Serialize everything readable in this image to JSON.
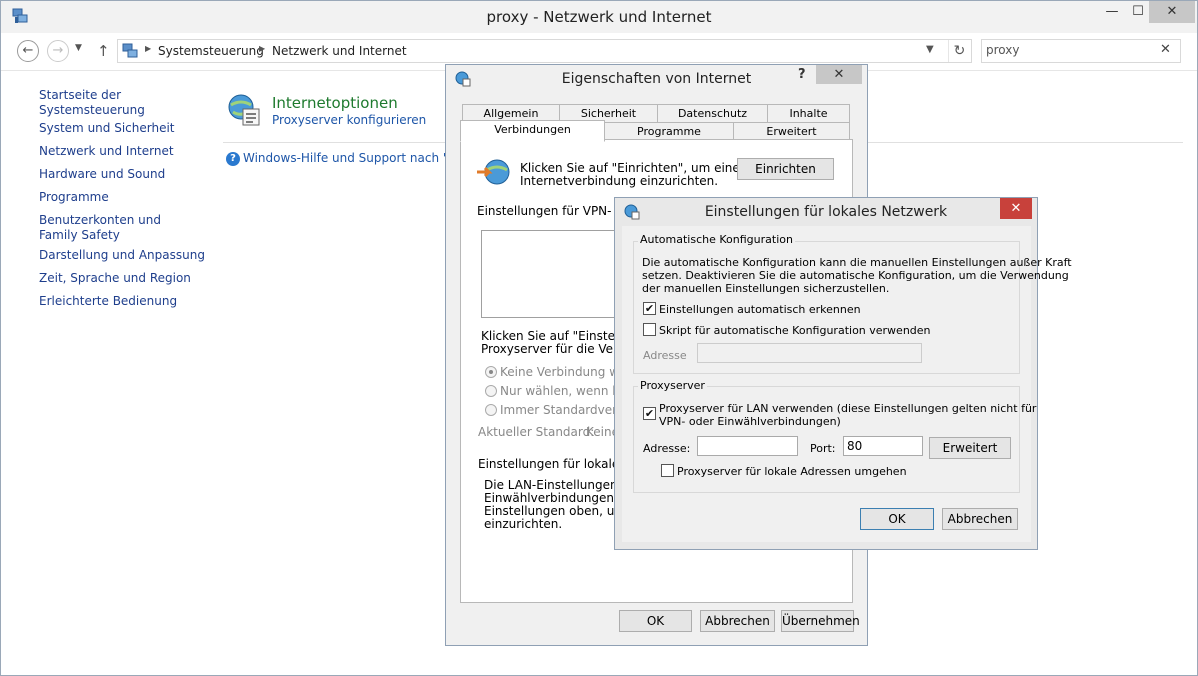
{
  "window": {
    "title": "proxy - Netzwerk und Internet",
    "min_icon": "minimize-icon",
    "max_icon": "maximize-icon",
    "close_icon": "close-icon"
  },
  "nav": {
    "breadcrumb": [
      "Systemsteuerung",
      "Netzwerk und Internet"
    ],
    "search_value": "proxy"
  },
  "sidebar": {
    "items": [
      {
        "label": "Startseite der Systemsteuerung"
      },
      {
        "label": "System und Sicherheit"
      },
      {
        "label": "Netzwerk und Internet"
      },
      {
        "label": "Hardware und Sound"
      },
      {
        "label": "Programme"
      },
      {
        "label": "Benutzerkonten und Family Safety"
      },
      {
        "label": "Darstellung und Anpassung"
      },
      {
        "label": "Zeit, Sprache und Region"
      },
      {
        "label": "Erleichterte Bedienung"
      }
    ]
  },
  "content": {
    "result_title": "Internetoptionen",
    "result_link": "Proxyserver konfigurieren",
    "help_link": "Windows-Hilfe und Support nach \"pro"
  },
  "inet_dialog": {
    "title": "Eigenschaften von Internet",
    "help": "?",
    "tabs_row1": [
      "Allgemein",
      "Sicherheit",
      "Datenschutz",
      "Inhalte"
    ],
    "tabs_row2": [
      "Verbindungen",
      "Programme",
      "Erweitert"
    ],
    "setup_text_1": "Klicken Sie auf \"Einrichten\", um eine",
    "setup_text_2": "Internetverbindung einzurichten.",
    "setup_button": "Einrichten",
    "vpn_heading": "Einstellungen für VPN- und Ei",
    "proxy_hint_1": "Klicken Sie auf \"Einstellunger",
    "proxy_hint_2": "Proxyserver für die Verbindu",
    "radio_options": [
      "Keine Verbindung wähle",
      "Nur wählen, wenn keine",
      "Immer Standardverbind"
    ],
    "current_default_label": "Aktueller Standard:",
    "current_default_value": "Keine",
    "lan_heading": "Einstellungen für lokales Net",
    "lan_text": [
      "Die LAN-Einstellungen gelte",
      "Einwählverbindungen. Bear",
      "Einstellungen oben, um Einw",
      "einzurichten."
    ],
    "ok": "OK",
    "cancel": "Abbrechen",
    "apply": "Übernehmen"
  },
  "lan_dialog": {
    "title": "Einstellungen für lokales Netzwerk",
    "auto_group": "Automatische Konfiguration",
    "auto_desc": [
      "Die automatische Konfiguration kann die manuellen Einstellungen außer Kraft",
      "setzen. Deaktivieren Sie die automatische Konfiguration, um die Verwendung",
      "der manuellen Einstellungen sicherzustellen."
    ],
    "auto_detect_label": "Einstellungen automatisch erkennen",
    "auto_detect_checked": true,
    "script_label": "Skript für automatische Konfiguration verwenden",
    "script_checked": false,
    "script_address_label": "Adresse",
    "script_address_value": "",
    "proxy_group": "Proxyserver",
    "use_proxy_label_1": "Proxyserver für LAN verwenden (diese Einstellungen gelten nicht für",
    "use_proxy_label_2": "VPN- oder Einwählverbindungen)",
    "use_proxy_checked": true,
    "address_label": "Adresse:",
    "address_value": "",
    "port_label": "Port:",
    "port_value": "80",
    "advanced_button": "Erweitert",
    "bypass_label": "Proxyserver für lokale Adressen umgehen",
    "bypass_checked": false,
    "ok": "OK",
    "cancel": "Abbrechen"
  },
  "colors": {
    "link": "#1e3e8c",
    "result_title": "#1e7a2e",
    "close_red": "#c8413b"
  }
}
